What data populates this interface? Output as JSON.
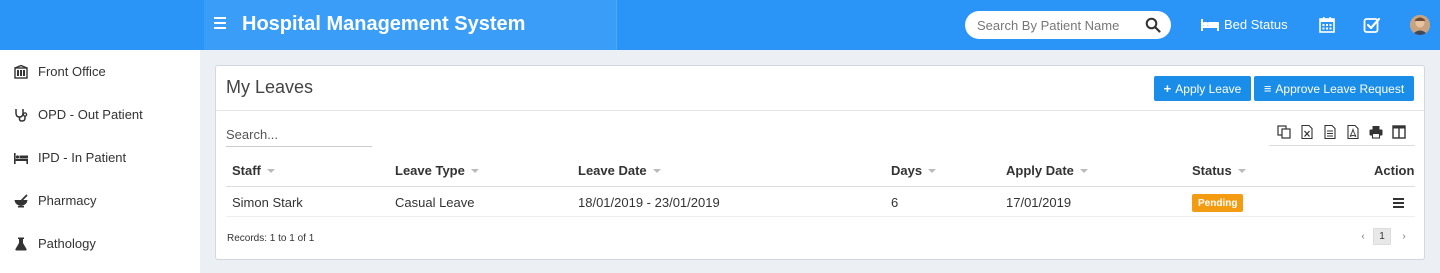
{
  "header": {
    "title": "Hospital Management System",
    "search_placeholder": "Search By Patient Name",
    "bed_status_label": "Bed Status",
    "icons": [
      "menu-icon",
      "search-icon",
      "bed-icon",
      "calendar-icon",
      "task-check-icon",
      "user-avatar"
    ]
  },
  "sidebar": {
    "items": [
      {
        "label": "Front Office",
        "icon": "front-office-icon"
      },
      {
        "label": "OPD - Out Patient",
        "icon": "stethoscope-icon"
      },
      {
        "label": "IPD - In Patient",
        "icon": "bed-icon"
      },
      {
        "label": "Pharmacy",
        "icon": "mortar-pestle-icon"
      },
      {
        "label": "Pathology",
        "icon": "flask-icon"
      }
    ]
  },
  "panel": {
    "title": "My Leaves",
    "apply_leave_label": "Apply Leave",
    "approve_leave_label": "Approve Leave Request",
    "search_placeholder": "Search...",
    "export_icons": [
      "copy-icon",
      "excel-icon",
      "csv-icon",
      "pdf-icon",
      "print-icon",
      "columns-icon"
    ],
    "columns": [
      "Staff",
      "Leave Type",
      "Leave Date",
      "Days",
      "Apply Date",
      "Status",
      "Action"
    ],
    "rows": [
      {
        "staff": "Simon Stark",
        "leave_type": "Casual Leave",
        "leave_date": "18/01/2019 - 23/01/2019",
        "days": "6",
        "apply_date": "17/01/2019",
        "status": "Pending"
      }
    ],
    "records_text": "Records: 1 to 1 of 1",
    "pagination": {
      "prev": "‹",
      "page": "1",
      "next": "›"
    }
  },
  "colors": {
    "header_bg": "#2a94f7",
    "button_bg": "#1a8de9",
    "pending_badge": "#f39c12",
    "body_bg": "#ecf0f5"
  }
}
